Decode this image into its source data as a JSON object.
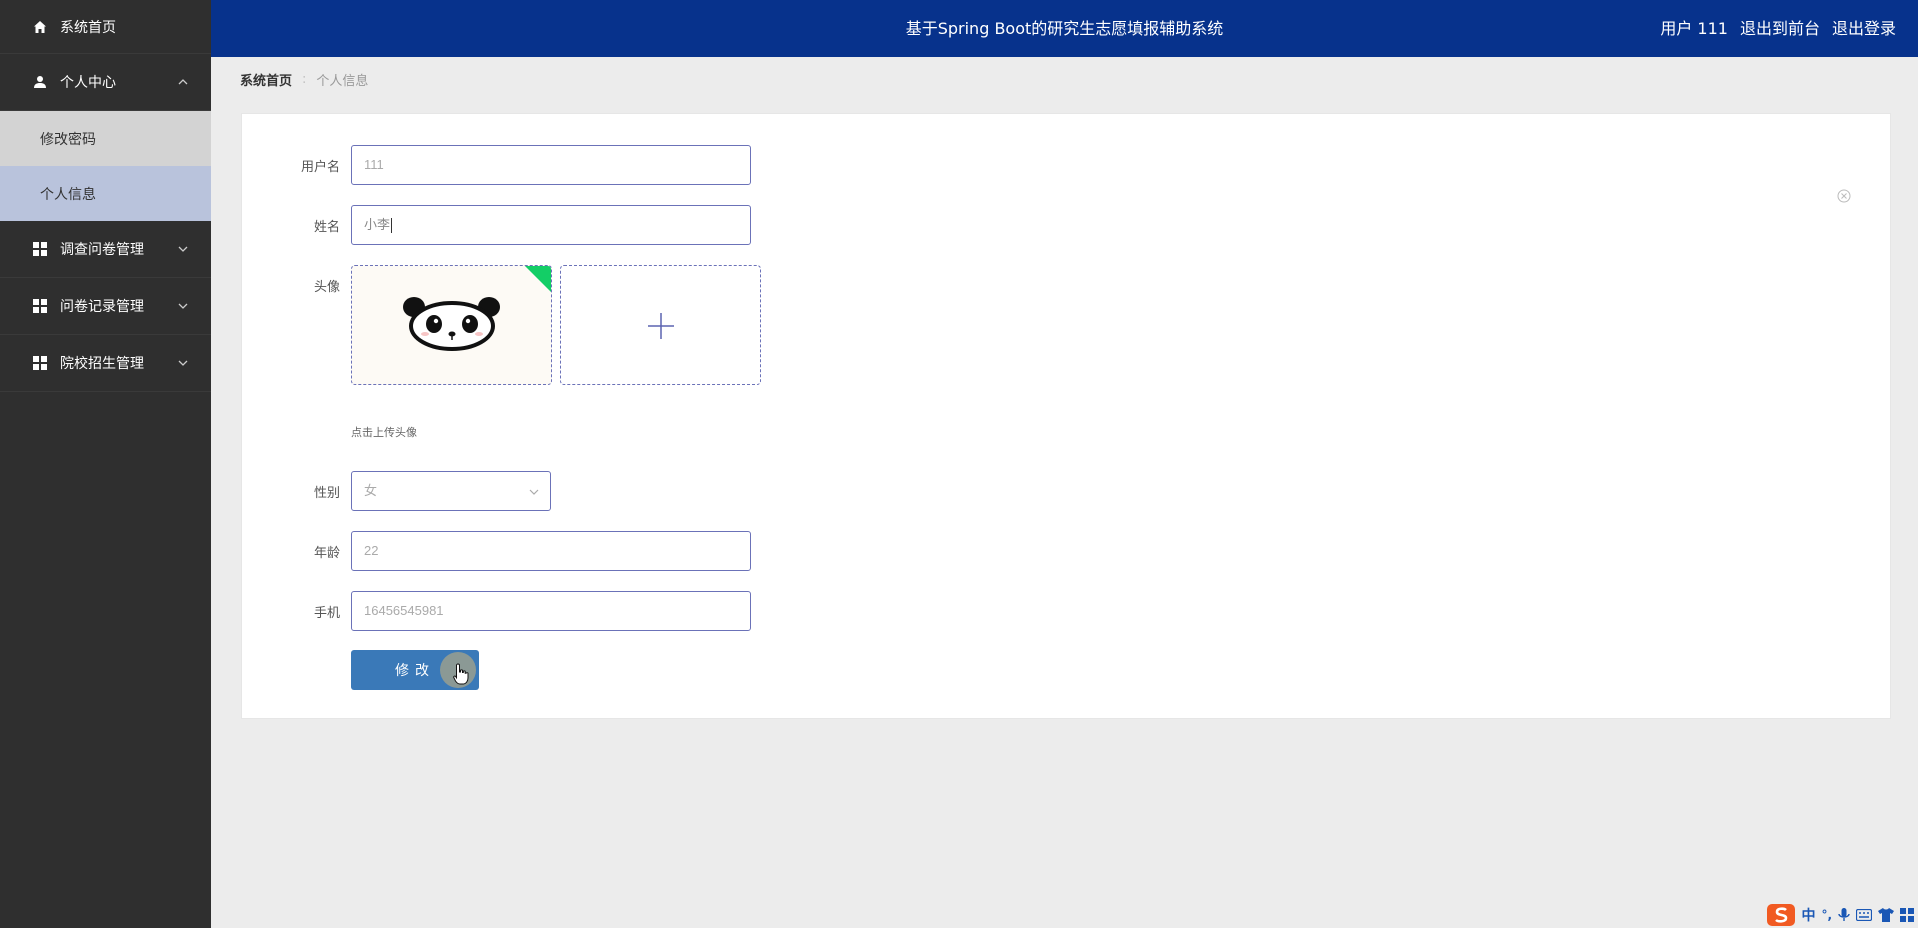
{
  "sidebar": {
    "home": "系统首页",
    "personal_center": "个人中心",
    "sub_items": [
      "修改密码",
      "个人信息"
    ],
    "menus": [
      "调查问卷管理",
      "问卷记录管理",
      "院校招生管理"
    ]
  },
  "header": {
    "title": "基于Spring Boot的研究生志愿填报辅助系统",
    "user": "用户 111",
    "back_front": "退出到前台",
    "logout": "退出登录"
  },
  "breadcrumb": {
    "home": "系统首页",
    "separator": ":",
    "current": "个人信息"
  },
  "form": {
    "username_label": "用户名",
    "username_value": "111",
    "name_label": "姓名",
    "name_value": "小李",
    "avatar_label": "头像",
    "avatar_hint": "点击上传头像",
    "gender_label": "性别",
    "gender_value": "女",
    "age_label": "年龄",
    "age_value": "22",
    "phone_label": "手机",
    "phone_value": "16456545981",
    "submit_label": "修改"
  },
  "ime": {
    "mode": "中",
    "punct": "°,"
  },
  "colors": {
    "header_bg": "#07328c",
    "sidebar_bg": "#2f2f2f",
    "active_sub_bg": "#b9c3dc",
    "button_bg": "#3a79b8",
    "upload_success": "#13ce66"
  }
}
